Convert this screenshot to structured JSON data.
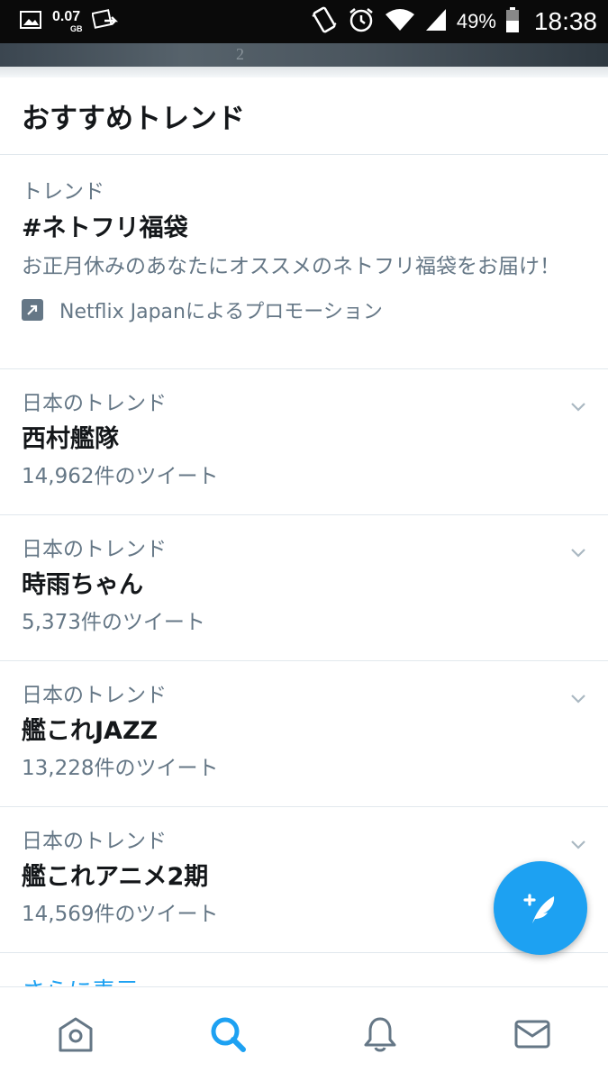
{
  "status_bar": {
    "data_amount": "0.07",
    "data_unit": "GB",
    "battery_percent": "49%",
    "time": "18:38",
    "icons": [
      "gallery-icon",
      "photo-share-icon",
      "vibrate-icon",
      "alarm-icon",
      "wifi-icon",
      "signal-icon",
      "battery-icon"
    ]
  },
  "header_photo_text": "2",
  "panel": {
    "title": "おすすめトレンド",
    "promoted": {
      "context": "トレンド",
      "name": "#ネトフリ福袋",
      "description": "お正月休みのあなたにオススメのネトフリ福袋をお届け！",
      "promoted_by": "Netflix Japanによるプロモーション",
      "icon": "promoted-arrow-icon"
    },
    "trends": [
      {
        "context": "日本のトレンド",
        "name": "西村艦隊",
        "count": "14,962件のツイート"
      },
      {
        "context": "日本のトレンド",
        "name": "時雨ちゃん",
        "count": "5,373件のツイート"
      },
      {
        "context": "日本のトレンド",
        "name": "艦これJAZZ",
        "count": "13,228件のツイート"
      },
      {
        "context": "日本のトレンド",
        "name": "艦これアニメ2期",
        "count": "14,569件のツイート"
      }
    ],
    "show_more": "さらに表示"
  },
  "fab": {
    "icon": "compose-tweet-icon"
  },
  "bottom_nav": {
    "items": [
      {
        "icon": "home-icon",
        "active": false
      },
      {
        "icon": "search-icon",
        "active": true
      },
      {
        "icon": "notifications-icon",
        "active": false
      },
      {
        "icon": "messages-icon",
        "active": false
      }
    ]
  },
  "colors": {
    "accent": "#1da1f2",
    "secondary_text": "#657786",
    "primary_text": "#14171a",
    "divider": "#e1e8ed",
    "status_bar": "#0a0a0a"
  }
}
